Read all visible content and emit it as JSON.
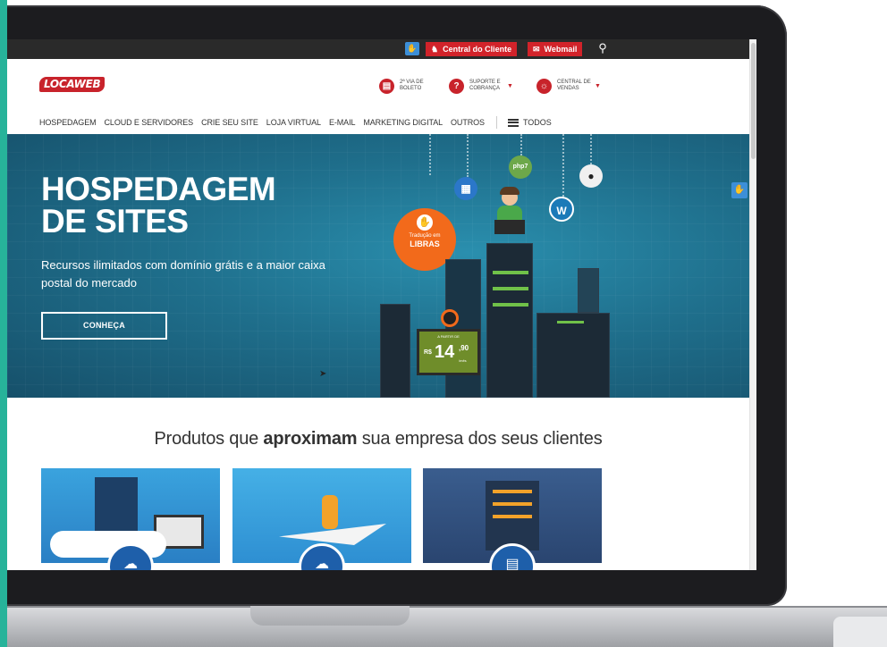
{
  "topbar": {
    "accessibility_icon": "accessibility-icon",
    "central_cliente": "Central do Cliente",
    "webmail": "Webmail",
    "search_icon": "search-icon"
  },
  "header": {
    "logo": "LOCAWEB",
    "links": [
      {
        "label": "2ª VIA DE BOLETO",
        "icon": "barcode-icon"
      },
      {
        "label": "SUPORTE E COBRANÇA",
        "icon": "help-icon"
      },
      {
        "label": "CENTRAL DE VENDAS",
        "icon": "headset-icon"
      }
    ]
  },
  "nav": {
    "items": [
      "HOSPEDAGEM",
      "CLOUD E SERVIDORES",
      "CRIE SEU SITE",
      "LOJA VIRTUAL",
      "E-MAIL",
      "MARKETING DIGITAL",
      "OUTROS"
    ],
    "all_label": "TODOS"
  },
  "hero": {
    "title_line1": "HOSPEDAGEM",
    "title_line2": "DE SITES",
    "subtitle": "Recursos ilimitados com domínio grátis e a maior caixa postal do mercado",
    "cta": "CONHEÇA",
    "libras_line1": "Tradução em",
    "libras_line2": "LIBRAS",
    "php_badge": "php7",
    "price": {
      "prefix": "A PARTIR DE",
      "currency": "R$",
      "value": "14",
      "cents": ",90",
      "unit": "/mês"
    },
    "colors": {
      "bg": "#1f6f8c",
      "accent": "#f26a1b"
    }
  },
  "products": {
    "title_pre": "Produtos que ",
    "title_bold": "aproximam",
    "title_post": " sua empresa dos seus clientes",
    "cards": [
      {
        "icon": "cloud-server-icon"
      },
      {
        "icon": "cloud-site-icon"
      },
      {
        "icon": "server-rack-icon"
      }
    ]
  },
  "colors": {
    "brand_red": "#c8232b",
    "teal": "#27b39a"
  }
}
